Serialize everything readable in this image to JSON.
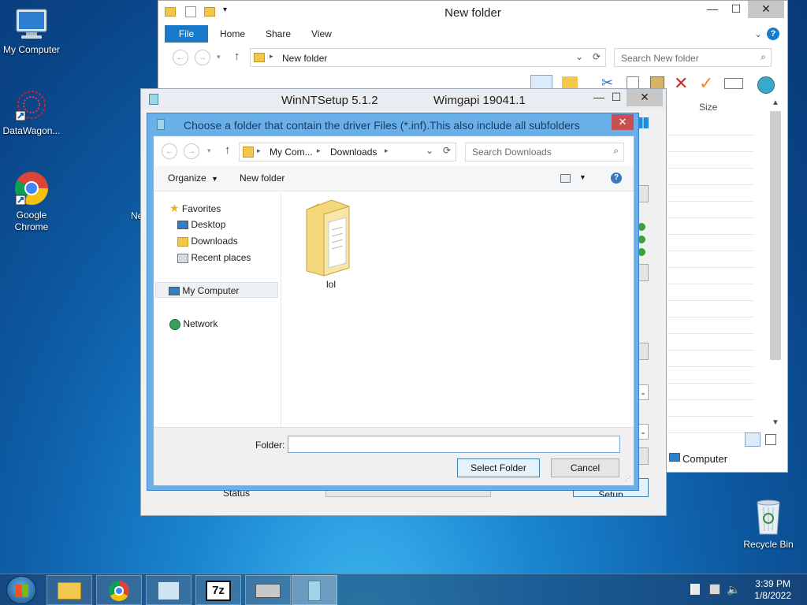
{
  "desktop": {
    "icons": [
      {
        "label": "My Computer"
      },
      {
        "label": "DataWagon..."
      },
      {
        "label": "Google Chrome"
      },
      {
        "label": "Recycle Bin"
      }
    ],
    "partial_label": "Ne"
  },
  "explorer": {
    "title": "New folder",
    "tabs": [
      "File",
      "Home",
      "Share",
      "View"
    ],
    "address": "New folder",
    "search_placeholder": "Search New folder",
    "column_size": "Size",
    "status_computer": "Computer"
  },
  "winntsetup": {
    "title": "WinNTSetup 5.1.2",
    "wimgapi": "Wimgapi 19041.1",
    "status_label": "Status",
    "setup_button": "Setup"
  },
  "dialog": {
    "title": "Choose a folder that contain the driver Files (*.inf).This also include all subfolders",
    "breadcrumb": [
      "My Com...",
      "Downloads"
    ],
    "search_placeholder": "Search Downloads",
    "organize": "Organize",
    "new_folder": "New folder",
    "nav": {
      "favorites": "Favorites",
      "desktop": "Desktop",
      "downloads": "Downloads",
      "recent": "Recent places",
      "my_computer": "My Computer",
      "network": "Network"
    },
    "items": [
      {
        "name": "lol"
      }
    ],
    "folder_label": "Folder:",
    "folder_value": "",
    "select_button": "Select Folder",
    "cancel_button": "Cancel"
  },
  "taskbar": {
    "time": "3:39 PM",
    "date": "1/8/2022",
    "items": [
      "file-explorer",
      "chrome",
      "control-panel",
      "7zip",
      "scanner",
      "winntsetup"
    ]
  },
  "colors": {
    "accent": "#1979ca",
    "dialog_frame": "#6ab0e8",
    "close_red": "#c75050"
  }
}
